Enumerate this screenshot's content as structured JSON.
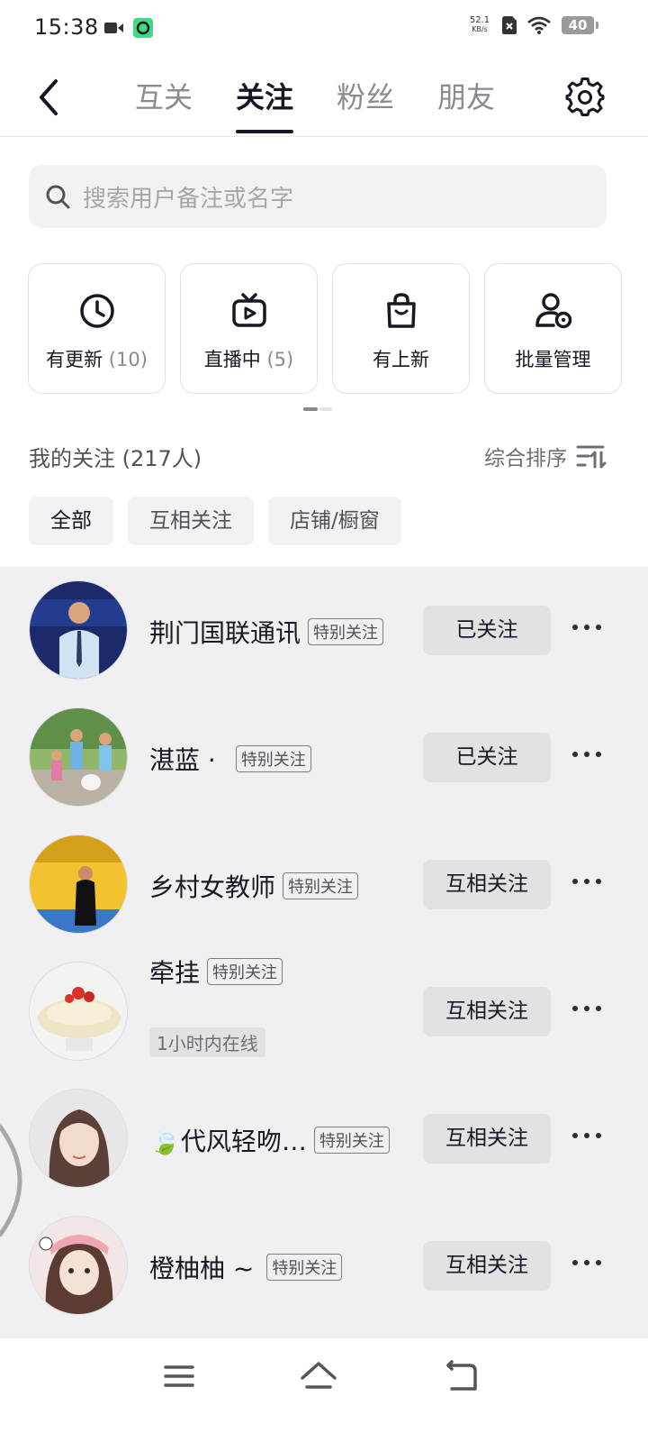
{
  "status_bar": {
    "time": "15:38",
    "net_speed_value": "52.1",
    "net_speed_unit": "KB/s",
    "battery": "40"
  },
  "header": {
    "tabs": [
      {
        "label": "互关",
        "active": false
      },
      {
        "label": "关注",
        "active": true
      },
      {
        "label": "粉丝",
        "active": false
      },
      {
        "label": "朋友",
        "active": false
      }
    ]
  },
  "search": {
    "placeholder": "搜索用户备注或名字"
  },
  "quick_cards": [
    {
      "icon": "clock-icon",
      "label": "有更新",
      "count": "(10)"
    },
    {
      "icon": "tv-icon",
      "label": "直播中",
      "count": "(5)"
    },
    {
      "icon": "bag-icon",
      "label": "有上新",
      "count": ""
    },
    {
      "icon": "user-settings-icon",
      "label": "批量管理",
      "count": ""
    }
  ],
  "follow_section": {
    "title": "我的关注 (217人)",
    "sort_label": "综合排序"
  },
  "filters": [
    {
      "label": "全部",
      "active": true
    },
    {
      "label": "互相关注",
      "active": false
    },
    {
      "label": "店铺/橱窗",
      "active": false
    }
  ],
  "users": [
    {
      "name": "荆门国联通讯",
      "badge": "特别关注",
      "status": "",
      "button": "已关注"
    },
    {
      "name": "湛蓝 ·",
      "badge": "特别关注",
      "status": "",
      "button": "已关注"
    },
    {
      "name": "乡村女教师",
      "badge": "特别关注",
      "status": "",
      "button": "互相关注"
    },
    {
      "name": "牵挂",
      "badge": "特别关注",
      "status": "1小时内在线",
      "button": "互相关注"
    },
    {
      "name": "🍃代风轻吻…",
      "badge": "特别关注",
      "status": "",
      "button": "互相关注"
    },
    {
      "name": "橙柚柚 ~",
      "badge": "特别关注",
      "status": "",
      "button": "互相关注"
    }
  ],
  "colors": {
    "accent_text": "#161823",
    "muted_text": "#8a8b91",
    "list_bg": "#f0f0f2",
    "button_bg": "#e2e2e5"
  }
}
